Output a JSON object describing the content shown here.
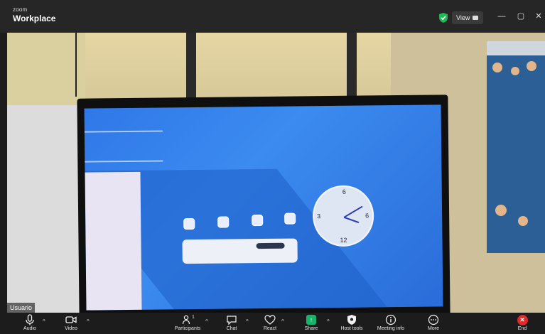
{
  "window": {
    "brand_small": "zoom",
    "brand_name": "Workplace",
    "view_label": "View",
    "minimize": "—",
    "maximize": "▢",
    "close": "✕",
    "secure_icon": "shield-check-icon",
    "secure_color": "#1db954"
  },
  "video": {
    "participant_name": "Usuario"
  },
  "toolbar": {
    "audio": "Audio",
    "video": "Video",
    "participants": "Participants",
    "participants_count": "1",
    "chat": "Chat",
    "react": "React",
    "share": "Share",
    "host_tools": "Host tools",
    "meeting_info": "Meeting info",
    "more": "More",
    "end": "End",
    "share_color": "#17b36b",
    "end_color": "#e02828"
  }
}
